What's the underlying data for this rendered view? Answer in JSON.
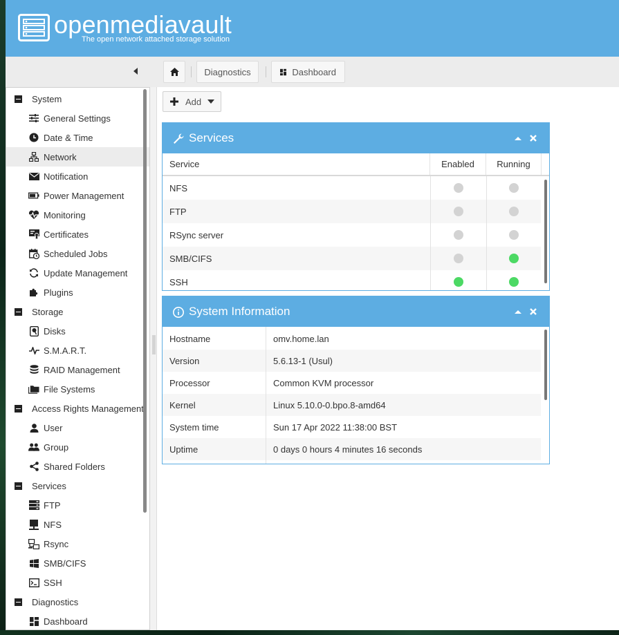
{
  "header": {
    "logo_text": "openmediavault",
    "tagline": "The open network attached storage solution"
  },
  "breadcrumb": {
    "home_icon": "home-icon",
    "items": [
      "Diagnostics",
      "Dashboard"
    ]
  },
  "sidebar": {
    "items": [
      {
        "label": "System",
        "type": "section",
        "icon": "minus-box-icon"
      },
      {
        "label": "General Settings",
        "type": "child",
        "icon": "sliders-icon"
      },
      {
        "label": "Date & Time",
        "type": "child",
        "icon": "clock-icon"
      },
      {
        "label": "Network",
        "type": "child",
        "icon": "network-icon",
        "active": true
      },
      {
        "label": "Notification",
        "type": "child",
        "icon": "envelope-icon"
      },
      {
        "label": "Power Management",
        "type": "child",
        "icon": "battery-icon"
      },
      {
        "label": "Monitoring",
        "type": "child",
        "icon": "heart-pulse-icon"
      },
      {
        "label": "Certificates",
        "type": "child",
        "icon": "certificate-icon"
      },
      {
        "label": "Scheduled Jobs",
        "type": "child",
        "icon": "calendar-clock-icon"
      },
      {
        "label": "Update Management",
        "type": "child",
        "icon": "refresh-icon"
      },
      {
        "label": "Plugins",
        "type": "child",
        "icon": "puzzle-icon"
      },
      {
        "label": "Storage",
        "type": "section",
        "icon": "minus-box-icon"
      },
      {
        "label": "Disks",
        "type": "child",
        "icon": "disk-icon"
      },
      {
        "label": "S.M.A.R.T.",
        "type": "child",
        "icon": "pulse-icon"
      },
      {
        "label": "RAID Management",
        "type": "child",
        "icon": "database-icon"
      },
      {
        "label": "File Systems",
        "type": "child",
        "icon": "folders-icon"
      },
      {
        "label": "Access Rights Management",
        "type": "section",
        "icon": "minus-box-icon"
      },
      {
        "label": "User",
        "type": "child",
        "icon": "user-icon"
      },
      {
        "label": "Group",
        "type": "child",
        "icon": "group-icon"
      },
      {
        "label": "Shared Folders",
        "type": "child",
        "icon": "share-icon"
      },
      {
        "label": "Services",
        "type": "section",
        "icon": "minus-box-icon"
      },
      {
        "label": "FTP",
        "type": "child",
        "icon": "server-icon"
      },
      {
        "label": "NFS",
        "type": "child",
        "icon": "monitor-icon"
      },
      {
        "label": "Rsync",
        "type": "child",
        "icon": "sync-network-icon"
      },
      {
        "label": "SMB/CIFS",
        "type": "child",
        "icon": "windows-icon"
      },
      {
        "label": "SSH",
        "type": "child",
        "icon": "terminal-icon"
      },
      {
        "label": "Diagnostics",
        "type": "section",
        "icon": "minus-box-icon"
      },
      {
        "label": "Dashboard",
        "type": "child",
        "icon": "dashboard-icon"
      }
    ]
  },
  "main": {
    "add_label": "Add",
    "services_panel": {
      "title": "Services",
      "columns": [
        "Service",
        "Enabled",
        "Running"
      ],
      "rows": [
        {
          "name": "NFS",
          "enabled": false,
          "running": false
        },
        {
          "name": "FTP",
          "enabled": false,
          "running": false
        },
        {
          "name": "RSync server",
          "enabled": false,
          "running": false
        },
        {
          "name": "SMB/CIFS",
          "enabled": false,
          "running": true
        },
        {
          "name": "SSH",
          "enabled": true,
          "running": true
        }
      ]
    },
    "sysinfo_panel": {
      "title": "System Information",
      "rows": [
        {
          "key": "Hostname",
          "value": "omv.home.lan"
        },
        {
          "key": "Version",
          "value": "5.6.13-1 (Usul)"
        },
        {
          "key": "Processor",
          "value": "Common KVM processor"
        },
        {
          "key": "Kernel",
          "value": "Linux 5.10.0-0.bpo.8-amd64"
        },
        {
          "key": "System time",
          "value": "Sun 17 Apr 2022 11:38:00 BST"
        },
        {
          "key": "Uptime",
          "value": "0 days 0 hours 4 minutes 16 seconds"
        }
      ]
    }
  },
  "colors": {
    "header_blue": "#5dade2",
    "status_on": "#4cd964",
    "status_off": "#d3d3d3"
  }
}
